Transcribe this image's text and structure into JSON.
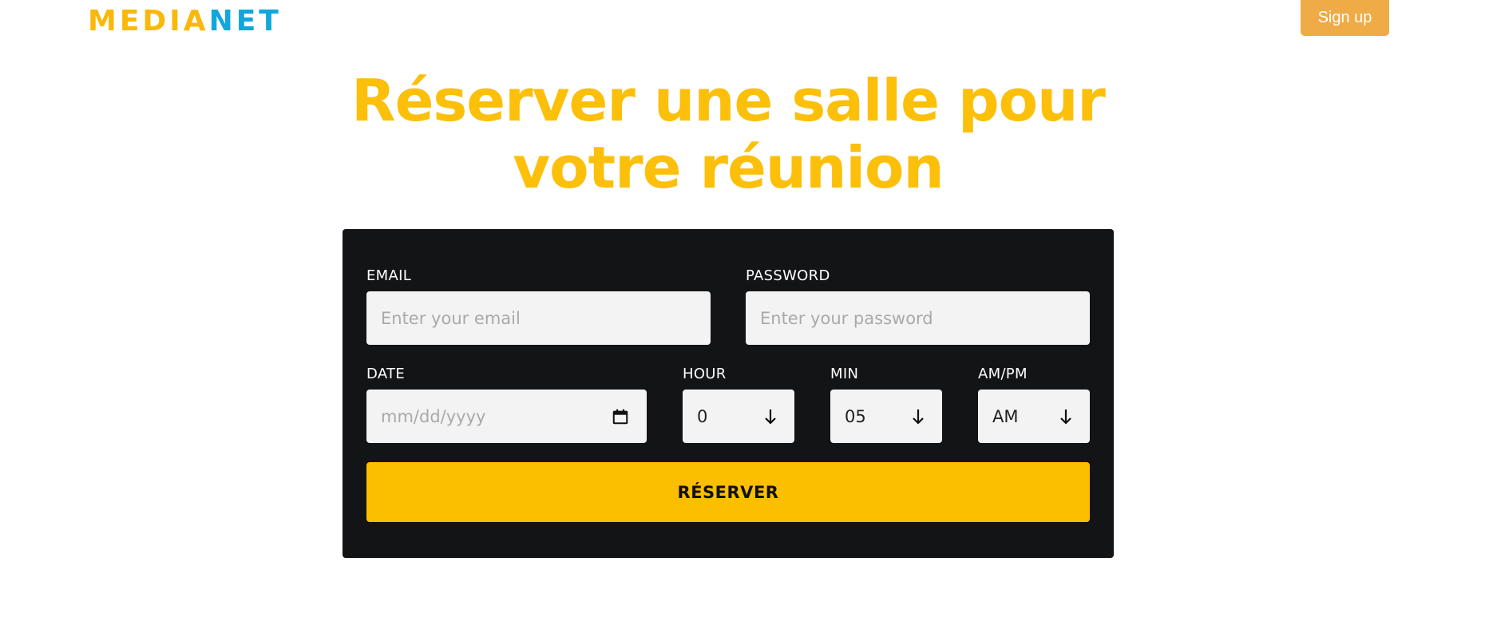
{
  "header": {
    "logo_part1": "MEDIA",
    "logo_part2": "NET",
    "signup_label": "Sign up"
  },
  "title": {
    "line1": "Réserver une salle pour",
    "line2": "votre réunion"
  },
  "form": {
    "email": {
      "label": "EMAIL",
      "placeholder": "Enter your email"
    },
    "password": {
      "label": "PASSWORD",
      "placeholder": "Enter your password"
    },
    "date": {
      "label": "DATE",
      "placeholder": "mm/dd/yyyy",
      "icon": "calendar-icon"
    },
    "hour": {
      "label": "HOUR",
      "value": "0",
      "icon": "arrow-down-icon"
    },
    "min": {
      "label": "MIN",
      "value": "05",
      "icon": "arrow-down-icon"
    },
    "ampm": {
      "label": "AM/PM",
      "value": "AM",
      "icon": "arrow-down-icon"
    },
    "submit_label": "RÉSERVER"
  },
  "colors": {
    "brand_yellow": "#fcbf0a",
    "brand_blue": "#11a7dc",
    "signup_orange": "#efab45",
    "card_background": "#131416",
    "field_background": "#f3f3f3"
  }
}
